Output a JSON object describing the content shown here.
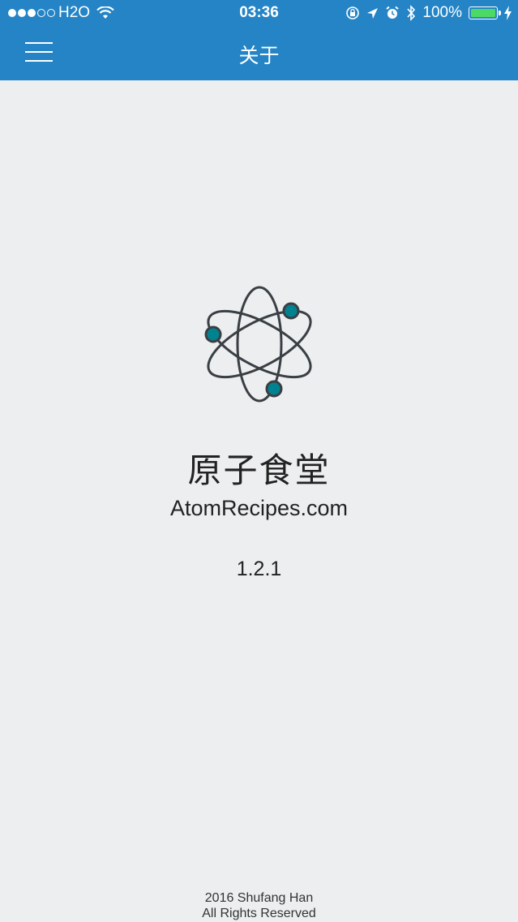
{
  "status_bar": {
    "carrier": "H2O",
    "time": "03:36",
    "battery_text": "100%",
    "battery_level": 1.0,
    "signal_strength": 3,
    "signal_max": 5
  },
  "nav": {
    "title": "关于",
    "menu_icon": "hamburger-menu-icon"
  },
  "about": {
    "logo_icon": "atom-icon",
    "app_name": "原子食堂",
    "website": "AtomRecipes.com",
    "version": "1.2.1"
  },
  "footer": {
    "copyright": "2016 Shufang Han",
    "rights": "All Rights Reserved"
  },
  "colors": {
    "header_bg": "#2484c6",
    "page_bg": "#eceef0",
    "logo_stroke": "#3a3f44",
    "logo_electron": "#00838f",
    "battery_fill": "#4cd964"
  }
}
